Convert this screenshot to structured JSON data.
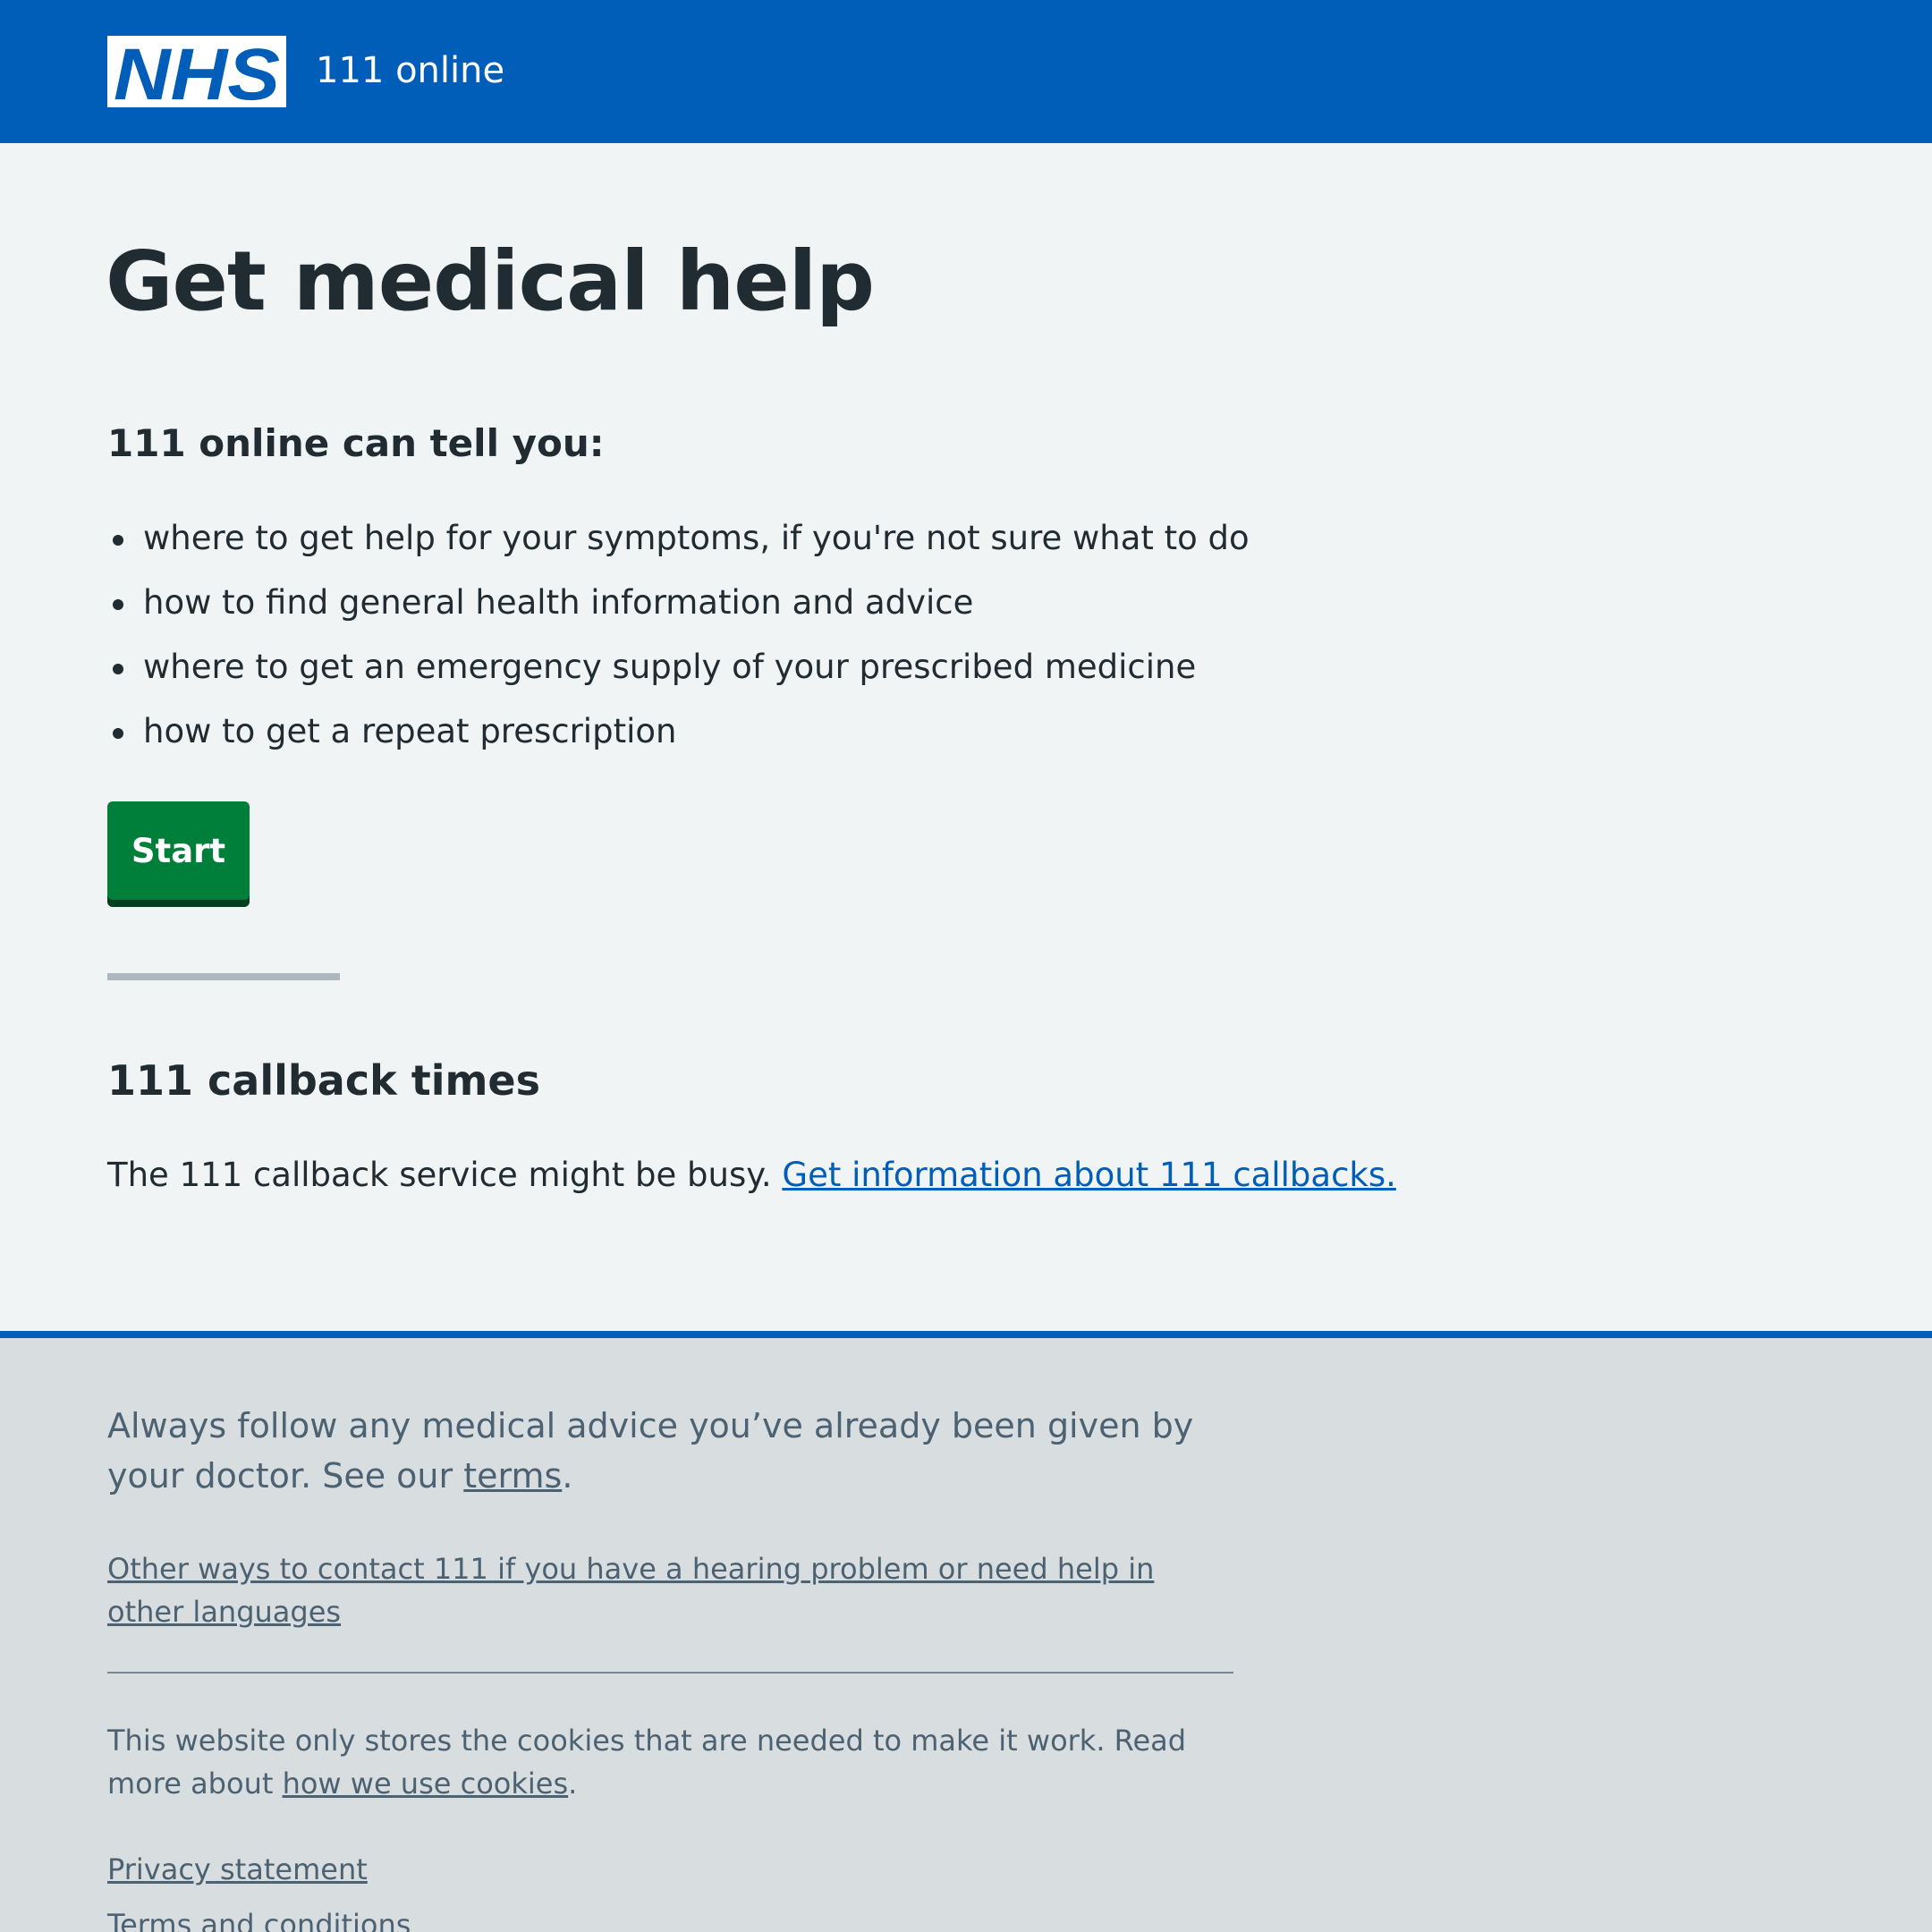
{
  "header": {
    "logo_text": "NHS",
    "service_name": "111 online"
  },
  "main": {
    "title": "Get medical help",
    "lead_heading": "111 online can tell you:",
    "bullets": [
      "where to get help for your symptoms, if you're not sure what to do",
      "how to find general health information and advice",
      "where to get an emergency supply of your prescribed medicine",
      "how to get a repeat prescription"
    ],
    "start_label": "Start",
    "callback_heading": "111 callback times",
    "callback_text": "The 111 callback service might be busy.",
    "callback_link": "Get information about 111 callbacks."
  },
  "footer": {
    "advice_text": "Always follow any medical advice you’ve already been given by your doctor. See our",
    "advice_link": "terms",
    "advice_end": ".",
    "contact_link": "Other ways to contact 111 if you have a hearing problem or need help in other languages",
    "cookies_text": "This website only stores the cookies that are needed to make it work. Read more about",
    "cookies_link": "how we use cookies",
    "cookies_end": ".",
    "privacy_link": "Privacy statement",
    "terms_link": "Terms and conditions"
  },
  "colors": {
    "nhs_blue": "#005eb8",
    "page_background": "#f0f4f5",
    "footer_background": "#d8dde0",
    "start_green": "#007f3b",
    "text": "#212b32",
    "footer_text": "#4c6272"
  },
  "icons": {
    "logo": "nhs-logo-icon",
    "bullet": "bullet-dot-icon"
  }
}
